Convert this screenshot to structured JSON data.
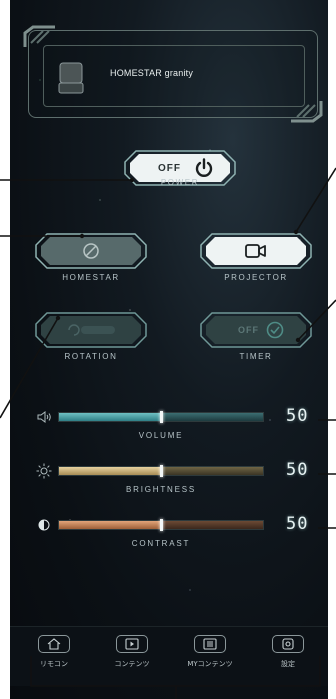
{
  "device": {
    "name": "HOMESTAR granity"
  },
  "buttons": {
    "power": {
      "state": "OFF",
      "label": "POWER"
    },
    "homestar": {
      "label": "HOMESTAR"
    },
    "projector": {
      "label": "PROJECTOR"
    },
    "rotation": {
      "label": "ROTATION"
    },
    "timer": {
      "state": "OFF",
      "label": "TIMER"
    }
  },
  "sliders": [
    {
      "key": "volume",
      "label": "VOLUME",
      "value": "50",
      "icon": "speaker-icon",
      "fill_fraction": 0.5
    },
    {
      "key": "brightness",
      "label": "BRIGHTNESS",
      "value": "50",
      "icon": "sun-icon",
      "fill_fraction": 0.5
    },
    {
      "key": "contrast",
      "label": "CONTRAST",
      "value": "50",
      "icon": "contrast-icon",
      "fill_fraction": 0.5
    }
  ],
  "nav": [
    {
      "label": "リモコン",
      "icon": "home-icon"
    },
    {
      "label": "コンテンツ",
      "icon": "film-icon"
    },
    {
      "label": "MYコンテンツ",
      "icon": "list-icon"
    },
    {
      "label": "設定",
      "icon": "gear-icon"
    }
  ],
  "colors": {
    "accent_teal": "#1fb5a6",
    "volume_fill": "#3e9ca1",
    "brightness_fill": "#c9b27c",
    "contrast_fill": "#c78a5e",
    "button_active": "#e9efef",
    "button_inactive": "#3a4f50"
  }
}
